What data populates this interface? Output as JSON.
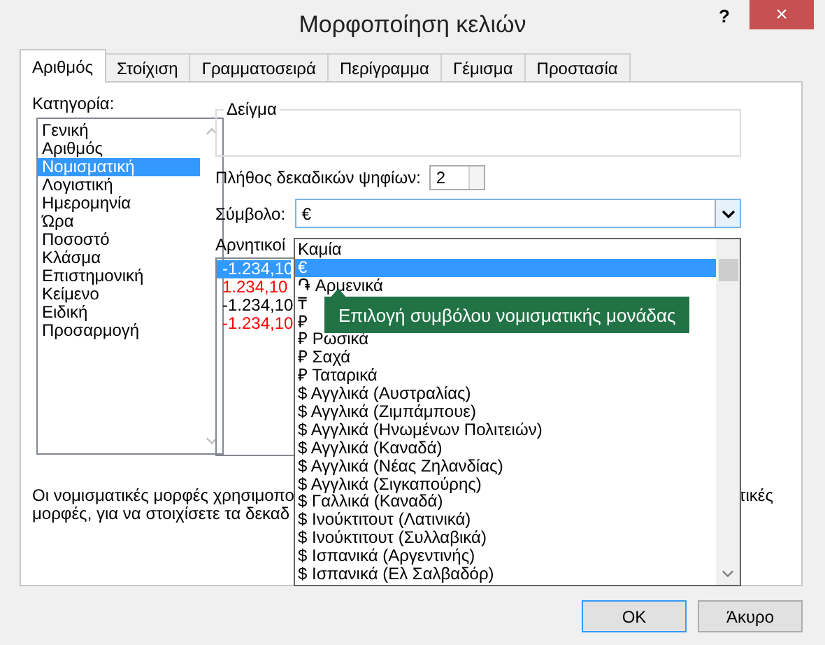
{
  "window": {
    "title": "Μορφοποίηση κελιών",
    "help": "?",
    "close": "×"
  },
  "tabs": [
    {
      "label": "Αριθμός",
      "selected": true
    },
    {
      "label": "Στοίχιση",
      "selected": false
    },
    {
      "label": "Γραμματοσειρά",
      "selected": false
    },
    {
      "label": "Περίγραμμα",
      "selected": false
    },
    {
      "label": "Γέμισμα",
      "selected": false
    },
    {
      "label": "Προστασία",
      "selected": false
    }
  ],
  "category": {
    "label": "Κατηγορία:",
    "items": [
      {
        "label": "Γενική",
        "selected": false
      },
      {
        "label": "Αριθμός",
        "selected": false
      },
      {
        "label": "Νομισματική",
        "selected": true
      },
      {
        "label": "Λογιστική",
        "selected": false
      },
      {
        "label": "Ημερομηνία",
        "selected": false
      },
      {
        "label": "Ώρα",
        "selected": false
      },
      {
        "label": "Ποσοστό",
        "selected": false
      },
      {
        "label": "Κλάσμα",
        "selected": false
      },
      {
        "label": "Επιστημονική",
        "selected": false
      },
      {
        "label": "Κείμενο",
        "selected": false
      },
      {
        "label": "Ειδική",
        "selected": false
      },
      {
        "label": "Προσαρμογή",
        "selected": false
      }
    ]
  },
  "sample": {
    "label": "Δείγμα"
  },
  "decimal_places": {
    "label": "Πλήθος δεκαδικών ψηφίων:",
    "value": "2"
  },
  "symbol": {
    "label": "Σύμβολο:",
    "value": "€",
    "options": [
      {
        "label": "Καμία",
        "selected": false
      },
      {
        "label": "€",
        "selected": true
      },
      {
        "label": "֏ Αρμενικά",
        "selected": false
      },
      {
        "label": "₸",
        "selected": false
      },
      {
        "label": "₽",
        "selected": false
      },
      {
        "label": "₽ Ρωσικά",
        "selected": false
      },
      {
        "label": "₽ Σαχά",
        "selected": false
      },
      {
        "label": "₽ Ταταρικά",
        "selected": false
      },
      {
        "label": "$ Αγγλικά (Αυστραλίας)",
        "selected": false
      },
      {
        "label": "$ Αγγλικά (Ζιμπάμπουε)",
        "selected": false
      },
      {
        "label": "$ Αγγλικά (Ηνωμένων Πολιτειών)",
        "selected": false
      },
      {
        "label": "$ Αγγλικά (Καναδά)",
        "selected": false
      },
      {
        "label": "$ Αγγλικά (Νέας Ζηλανδίας)",
        "selected": false
      },
      {
        "label": "$ Αγγλικά (Σιγκαπούρης)",
        "selected": false
      },
      {
        "label": "$ Γαλλικά (Καναδά)",
        "selected": false
      },
      {
        "label": "$ Ινούκτιτουτ (Λατινικά)",
        "selected": false
      },
      {
        "label": "$ Ινούκτιτουτ (Συλλαβικά)",
        "selected": false
      },
      {
        "label": "$ Ισπανικά (Αργεντινής)",
        "selected": false
      },
      {
        "label": "$ Ισπανικά (Ελ Σαλβαδόρ)",
        "selected": false
      }
    ]
  },
  "negative_numbers": {
    "label": "Αρνητικοί",
    "items": [
      {
        "text": "-1.234,10",
        "selected": true
      },
      {
        "text": "1.234,10",
        "color": "#ff0000",
        "selected": false
      },
      {
        "text": "-1.234,10",
        "color": "#000000",
        "selected": false
      },
      {
        "text": "-1.234,10",
        "color": "#ff0000",
        "selected": false
      }
    ]
  },
  "tooltip": "Επιλογή συμβόλου νομισματικής μονάδας",
  "description": {
    "left_lines": [
      "Οι νομισματικές μορφές χρησιμοπο",
      "μορφές, για να στοιχίσετε τα δεκαδ"
    ],
    "right_lines": [
      "τικές"
    ]
  },
  "buttons": [
    {
      "label": "OK",
      "default": true
    },
    {
      "label": "Άκυρο",
      "default": false
    }
  ]
}
